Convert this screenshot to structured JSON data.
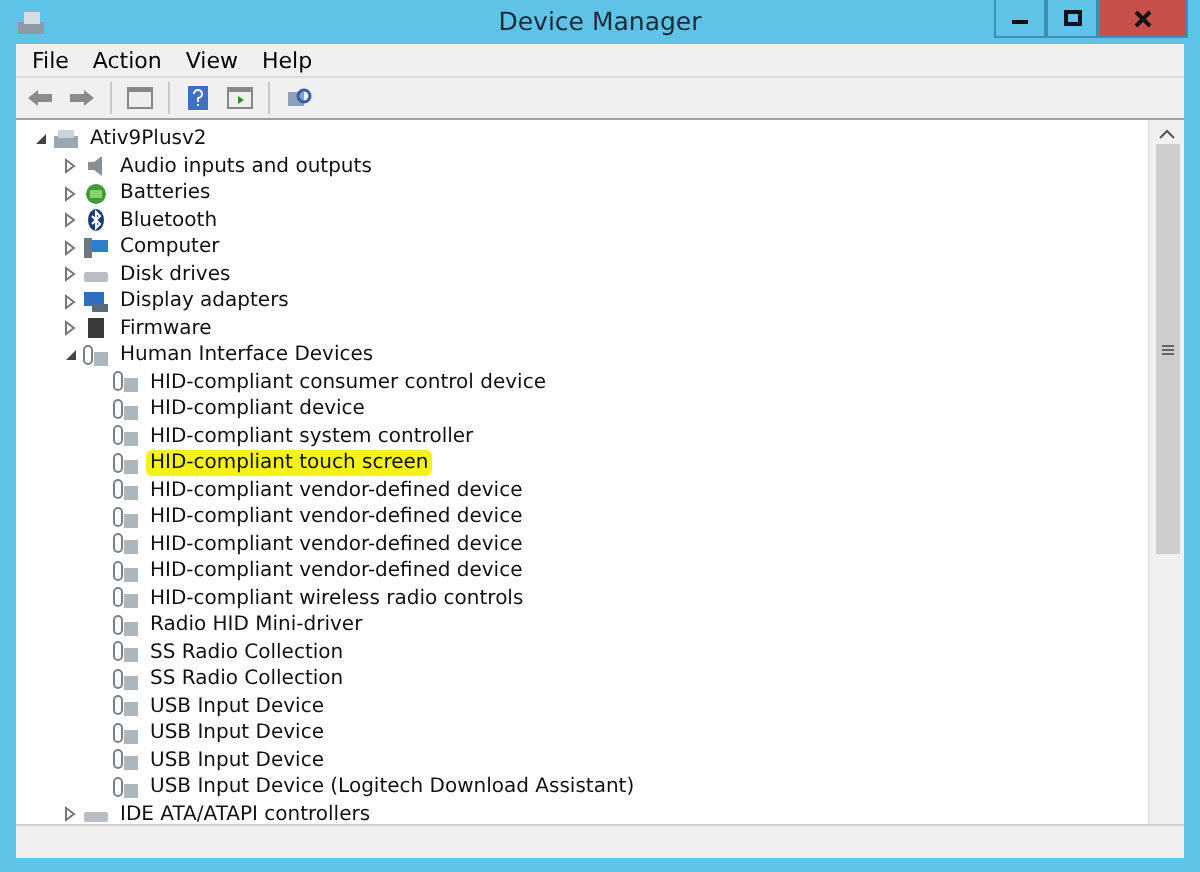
{
  "window": {
    "title": "Device Manager"
  },
  "menu": [
    "File",
    "Action",
    "View",
    "Help"
  ],
  "tree": {
    "label": "Ativ9Plusv2",
    "kind": "computer",
    "expanded": true,
    "children": [
      {
        "label": "Audio inputs and outputs",
        "kind": "audio",
        "expanded": false
      },
      {
        "label": "Batteries",
        "kind": "battery",
        "expanded": false
      },
      {
        "label": "Bluetooth",
        "kind": "bluetooth",
        "expanded": false
      },
      {
        "label": "Computer",
        "kind": "monitor",
        "expanded": false
      },
      {
        "label": "Disk drives",
        "kind": "disk",
        "expanded": false
      },
      {
        "label": "Display adapters",
        "kind": "display",
        "expanded": false
      },
      {
        "label": "Firmware",
        "kind": "firmware",
        "expanded": false
      },
      {
        "label": "Human Interface Devices",
        "kind": "hid",
        "expanded": true,
        "children": [
          {
            "label": "HID-compliant consumer control device",
            "kind": "hid",
            "highlighted": false
          },
          {
            "label": "HID-compliant device",
            "kind": "hid",
            "highlighted": false
          },
          {
            "label": "HID-compliant system controller",
            "kind": "hid",
            "highlighted": false
          },
          {
            "label": "HID-compliant touch screen",
            "kind": "hid",
            "highlighted": true
          },
          {
            "label": "HID-compliant vendor-defined device",
            "kind": "hid",
            "highlighted": false
          },
          {
            "label": "HID-compliant vendor-defined device",
            "kind": "hid",
            "highlighted": false
          },
          {
            "label": "HID-compliant vendor-defined device",
            "kind": "hid",
            "highlighted": false
          },
          {
            "label": "HID-compliant vendor-defined device",
            "kind": "hid",
            "highlighted": false
          },
          {
            "label": "HID-compliant wireless radio controls",
            "kind": "hid",
            "highlighted": false
          },
          {
            "label": "Radio HID Mini-driver",
            "kind": "hid",
            "highlighted": false
          },
          {
            "label": "SS Radio Collection",
            "kind": "hid",
            "highlighted": false
          },
          {
            "label": "SS Radio Collection",
            "kind": "hid",
            "highlighted": false
          },
          {
            "label": "USB Input Device",
            "kind": "hid",
            "highlighted": false
          },
          {
            "label": "USB Input Device",
            "kind": "hid",
            "highlighted": false
          },
          {
            "label": "USB Input Device",
            "kind": "hid",
            "highlighted": false
          },
          {
            "label": "USB Input Device (Logitech Download Assistant)",
            "kind": "hid",
            "highlighted": false
          }
        ]
      },
      {
        "label": "IDE ATA/ATAPI controllers",
        "kind": "disk",
        "expanded": false
      }
    ]
  }
}
